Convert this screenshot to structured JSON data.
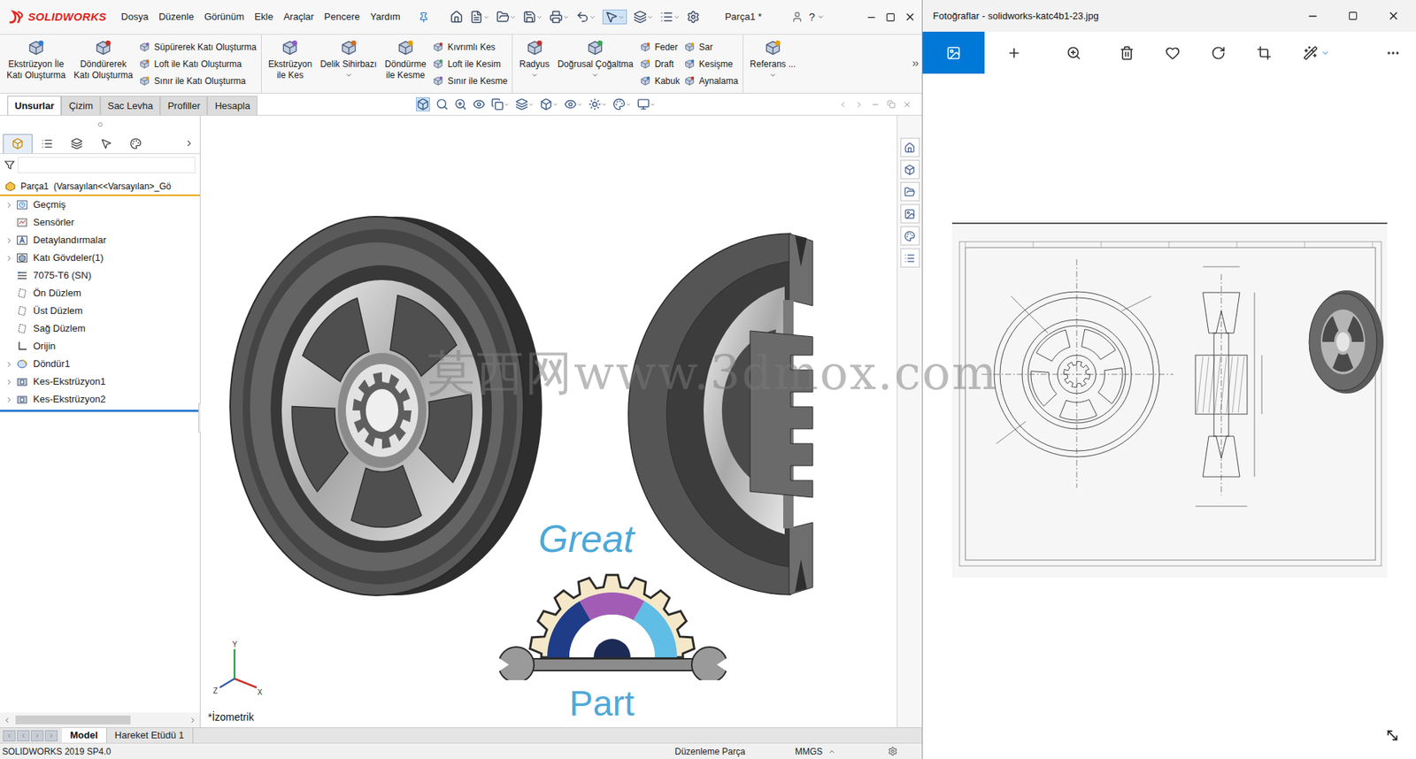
{
  "solidworks": {
    "logo": "SOLIDWORKS",
    "menu": [
      "Dosya",
      "Düzenle",
      "Görünüm",
      "Ekle",
      "Araçlar",
      "Pencere",
      "Yardım"
    ],
    "document": "Parça1 *",
    "help": "?",
    "ribbon": [
      [
        {
          "kind": "large",
          "lines": [
            "Ekstrüzyon İle",
            "Katı Oluşturma"
          ],
          "dropdown": false
        },
        {
          "kind": "large",
          "lines": [
            "Döndürerek",
            "Katı Oluşturma"
          ],
          "dropdown": false
        },
        {
          "kind": "stack",
          "items": [
            "Süpürerek Katı Oluşturma",
            "Loft ile Katı Oluşturma",
            "Sınır ile Katı Oluşturma"
          ]
        }
      ],
      [
        {
          "kind": "large",
          "lines": [
            "Ekstrüzyon",
            "ile Kes"
          ],
          "dropdown": false
        },
        {
          "kind": "large",
          "lines": [
            "Delik Sihirbazı"
          ],
          "dropdown": true
        },
        {
          "kind": "large",
          "lines": [
            "Döndürme",
            "ile Kesme"
          ],
          "dropdown": false
        },
        {
          "kind": "stack",
          "items": [
            "Kıvrımlı Kes",
            "Loft ile Kesim",
            "Sınır ile Kesme"
          ]
        }
      ],
      [
        {
          "kind": "large",
          "lines": [
            "Radyus"
          ],
          "dropdown": true
        },
        {
          "kind": "large",
          "lines": [
            "Doğrusal Çoğaltma"
          ],
          "dropdown": true
        },
        {
          "kind": "stack",
          "items": [
            "Feder",
            "Draft",
            "Kabuk"
          ]
        },
        {
          "kind": "stack",
          "items": [
            "Sar",
            "Kesişme",
            "Aynalama"
          ]
        }
      ],
      [
        {
          "kind": "large",
          "lines": [
            "Referans ..."
          ],
          "dropdown": true
        }
      ]
    ],
    "tabs": [
      {
        "label": "Unsurlar",
        "selected": true
      },
      {
        "label": "Çizim",
        "selected": false
      },
      {
        "label": "Sac Levha",
        "selected": false
      },
      {
        "label": "Profiller",
        "selected": false
      },
      {
        "label": "Hesapla",
        "selected": false
      }
    ],
    "panel_tabs": [
      {
        "selected": true
      },
      {
        "selected": false
      },
      {
        "selected": false
      },
      {
        "selected": false
      },
      {
        "selected": false
      }
    ],
    "tree": {
      "root": "Parça1  (Varsayılan<<Varsayılan>_Gö",
      "items": [
        {
          "label": "Geçmiş",
          "kind": "history",
          "expandable": true,
          "expanded": false
        },
        {
          "label": "Sensörler",
          "kind": "sensor",
          "expandable": false,
          "expanded": false
        },
        {
          "label": "Detaylandırmalar",
          "kind": "annotation",
          "expandable": true,
          "expanded": false
        },
        {
          "label": "Katı Gövdeler(1)",
          "kind": "bodies",
          "expandable": true,
          "expanded": false
        },
        {
          "label": "7075-T6 (SN)",
          "kind": "material",
          "expandable": false,
          "expanded": false
        },
        {
          "label": "Ön Düzlem",
          "kind": "plane",
          "expandable": false,
          "expanded": false
        },
        {
          "label": "Üst Düzlem",
          "kind": "plane",
          "expandable": false,
          "expanded": false
        },
        {
          "label": "Sağ Düzlem",
          "kind": "plane",
          "expandable": false,
          "expanded": false
        },
        {
          "label": "Orijin",
          "kind": "origin",
          "expandable": false,
          "expanded": false
        },
        {
          "label": "Döndür1",
          "kind": "revolve",
          "expandable": true,
          "expanded": false
        },
        {
          "label": "Kes-Ekstrüzyon1",
          "kind": "cut",
          "expandable": true,
          "expanded": false
        },
        {
          "label": "Kes-Ekstrüzyon2",
          "kind": "cut",
          "expandable": true,
          "expanded": false
        }
      ]
    },
    "viewport": {
      "view_label": "*İzometrik",
      "triad": [
        "Y",
        "Z",
        "X"
      ],
      "logo_top": "Great",
      "logo_bottom": "Part"
    },
    "bottom_tabs": [
      {
        "label": "Model",
        "selected": true
      },
      {
        "label": "Hareket Etüdü 1",
        "selected": false
      }
    ],
    "status_bar": {
      "version": "SOLIDWORKS 2019 SP4.0",
      "mode": "Düzenleme Parça",
      "units": "MMGS"
    }
  },
  "photos": {
    "title": "Fotoğraflar - solidworks-katc4b1-23.jpg",
    "toolbar": [
      {
        "selected": true
      },
      {
        "selected": false
      },
      {
        "selected": false
      },
      {
        "selected": false
      },
      {
        "selected": false
      },
      {
        "selected": false
      },
      {
        "selected": false
      },
      {
        "selected": false
      },
      {
        "selected": false
      }
    ]
  },
  "watermark": "莫西网www.3dmox.com"
}
